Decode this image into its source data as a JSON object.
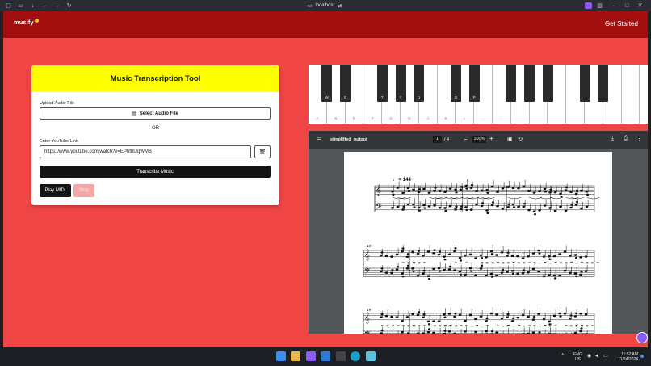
{
  "browser": {
    "url": "localhost",
    "buttons": [
      "workspaces-icon",
      "tabs-icon",
      "download-icon",
      "back-icon",
      "forward-icon",
      "refresh-icon"
    ]
  },
  "header": {
    "logo": "musify",
    "get_started": "Get Started"
  },
  "tool": {
    "title": "Music Transcription Tool",
    "upload_label": "Upload Audio File",
    "select_button": "Select Audio File",
    "or_text": "OR",
    "youtube_label": "Enter YouTube Link",
    "youtube_value": "https://www.youtube.com/watch?v=EPhfbtJqWMB",
    "transcribe_button": "Transcribe Music",
    "play_midi_button": "Play MIDI",
    "stop_button": "Stop"
  },
  "piano": {
    "white_keys": [
      "A",
      "S",
      "D",
      "F",
      "G",
      "H",
      "J",
      "K",
      "L",
      ";",
      "'",
      "",
      "",
      "",
      "",
      "",
      "",
      ""
    ],
    "black_keys": [
      "W",
      "E",
      "T",
      "Y",
      "U",
      "O",
      "P",
      "",
      "",
      "",
      "",
      ""
    ]
  },
  "pdf": {
    "filename": "simplified_output",
    "page_current": "1",
    "page_total": "/ 4",
    "zoom": "100%",
    "tempo_mark": "♩ = 144",
    "measure_numbers": [
      "10",
      "19"
    ]
  },
  "taskbar": {
    "lang_line1": "ENG",
    "lang_line2": "US",
    "time": "11:52 AM",
    "date": "11/24/2024"
  },
  "colors": {
    "header": "#a30f0f",
    "app_bg": "#ef4545",
    "panel_head": "#ffff00"
  }
}
